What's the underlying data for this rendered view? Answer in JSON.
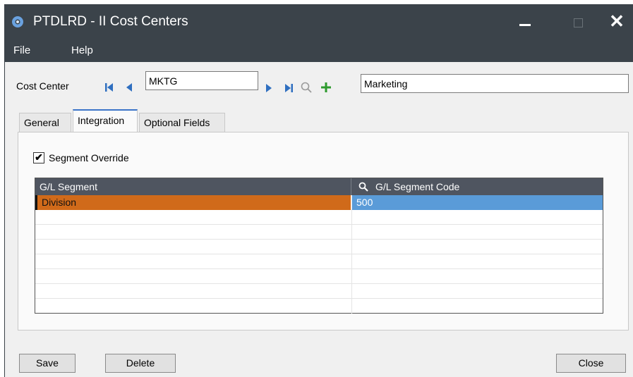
{
  "window": {
    "title": "PTDLRD - II Cost Centers",
    "minimize_glyph": "",
    "close_glyph": "✕"
  },
  "menu": {
    "items": [
      "File",
      "Help"
    ]
  },
  "cost_center": {
    "label": "Cost Center",
    "code_value": "MKTG",
    "description_value": "Marketing",
    "nav_icons": [
      "first-record-icon",
      "previous-record-icon",
      "next-record-icon",
      "last-record-icon",
      "search-icon",
      "add-icon"
    ]
  },
  "tabs": [
    {
      "label": "General",
      "active": false
    },
    {
      "label": "Integration",
      "active": true
    },
    {
      "label": "Optional Fields",
      "active": false
    }
  ],
  "segment_override": {
    "label": "Segment Override",
    "checked": true,
    "check_glyph": "✔"
  },
  "grid": {
    "columns": [
      "G/L Segment",
      "G/L Segment Code"
    ],
    "rows": [
      {
        "segment": "Division",
        "code": "500",
        "selected": true
      },
      {
        "segment": "",
        "code": ""
      },
      {
        "segment": "",
        "code": ""
      },
      {
        "segment": "",
        "code": ""
      },
      {
        "segment": "",
        "code": ""
      },
      {
        "segment": "",
        "code": ""
      },
      {
        "segment": "",
        "code": ""
      },
      {
        "segment": "",
        "code": ""
      }
    ]
  },
  "buttons": {
    "save": "Save",
    "delete": "Delete",
    "close": "Close"
  },
  "colors": {
    "titlebar": "#3b434a",
    "nav_arrow": "#2f6fc0",
    "add_icon": "#2e9a2e",
    "row_selected_segment": "#d06a1a",
    "row_selected_code": "#5a9bd8"
  }
}
